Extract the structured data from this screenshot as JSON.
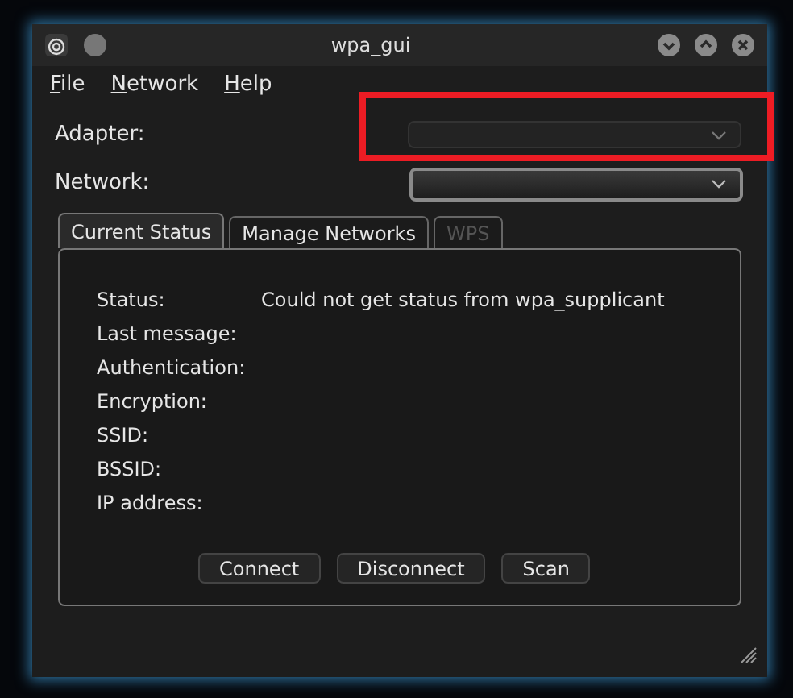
{
  "window": {
    "title": "wpa_gui"
  },
  "menu": [
    {
      "label": "File"
    },
    {
      "label": "Network"
    },
    {
      "label": "Help"
    }
  ],
  "adapter": {
    "label": "Adapter:",
    "disabled": true
  },
  "network": {
    "label": "Network:",
    "disabled": false
  },
  "tabs": [
    {
      "label": "Current Status",
      "selected": true,
      "disabled": false
    },
    {
      "label": "Manage Networks",
      "selected": false,
      "disabled": false
    },
    {
      "label": "WPS",
      "selected": false,
      "disabled": true
    }
  ],
  "status": [
    {
      "label": "Status:",
      "value": "Could not get status from wpa_supplicant"
    },
    {
      "label": "Last message:"
    },
    {
      "label": "Authentication:"
    },
    {
      "label": "Encryption:"
    },
    {
      "label": "SSID:"
    },
    {
      "label": "BSSID:"
    },
    {
      "label": "IP address:"
    }
  ],
  "buttons": [
    "Connect",
    "Disconnect",
    "Scan"
  ]
}
